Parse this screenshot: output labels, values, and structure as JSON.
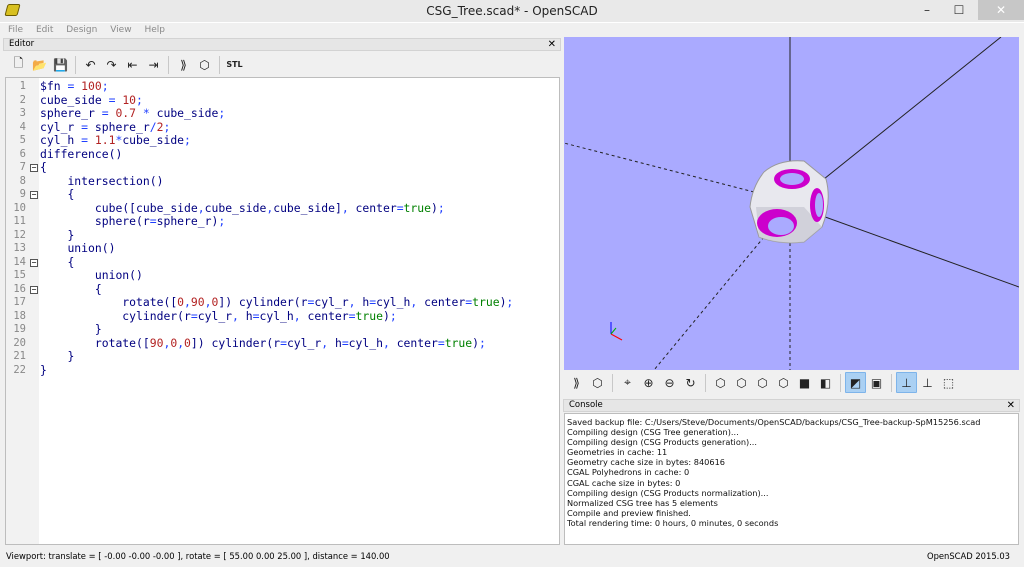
{
  "window": {
    "title": "CSG_Tree.scad* - OpenSCAD",
    "minimize": "–",
    "maximize": "☐",
    "close": "✕"
  },
  "menu": [
    "File",
    "Edit",
    "Design",
    "View",
    "Help"
  ],
  "editor": {
    "title": "Editor",
    "close": "✕",
    "toolbar": [
      {
        "name": "new-icon",
        "glyph": "🗋"
      },
      {
        "name": "open-icon",
        "glyph": "📂"
      },
      {
        "name": "save-icon",
        "glyph": "💾"
      },
      {
        "sep": true
      },
      {
        "name": "undo-icon",
        "glyph": "↶"
      },
      {
        "name": "redo-icon",
        "glyph": "↷"
      },
      {
        "name": "unindent-icon",
        "glyph": "⇤"
      },
      {
        "name": "indent-icon",
        "glyph": "⇥"
      },
      {
        "sep": true
      },
      {
        "name": "preview-icon",
        "glyph": "⟫"
      },
      {
        "name": "render-icon",
        "glyph": "⬡"
      },
      {
        "sep": true
      },
      {
        "name": "export-stl-icon",
        "glyph": "STL"
      }
    ],
    "lines": [
      "$fn = 100;",
      "cube_side = 10;",
      "sphere_r = 0.7 * cube_side;",
      "cyl_r = sphere_r/2;",
      "cyl_h = 1.1*cube_side;",
      "difference()",
      "{",
      "    intersection()",
      "    {",
      "        cube([cube_side,cube_side,cube_side], center=true);",
      "        sphere(r=sphere_r);",
      "    }",
      "    union()",
      "    {",
      "        union()",
      "        {",
      "            rotate([0,90,0]) cylinder(r=cyl_r, h=cyl_h, center=true);",
      "            cylinder(r=cyl_r, h=cyl_h, center=true);",
      "        }",
      "        rotate([90,0,0]) cylinder(r=cyl_r, h=cyl_h, center=true);",
      "    }",
      "}"
    ],
    "fold_lines": [
      7,
      9,
      14,
      16
    ]
  },
  "view_toolbar": [
    {
      "name": "preview-icon",
      "glyph": "⟫"
    },
    {
      "name": "render-icon",
      "glyph": "⬡"
    },
    {
      "sep": true
    },
    {
      "name": "view-all-icon",
      "glyph": "⌖"
    },
    {
      "name": "zoom-in-icon",
      "glyph": "⊕"
    },
    {
      "name": "zoom-out-icon",
      "glyph": "⊖"
    },
    {
      "name": "reset-view-icon",
      "glyph": "↻"
    },
    {
      "sep": true
    },
    {
      "name": "view-right-icon",
      "glyph": "⬡"
    },
    {
      "name": "view-top-icon",
      "glyph": "⬡"
    },
    {
      "name": "view-bottom-icon",
      "glyph": "⬡"
    },
    {
      "name": "view-left-icon",
      "glyph": "⬡"
    },
    {
      "name": "view-front-icon",
      "glyph": "■"
    },
    {
      "name": "view-back-icon",
      "glyph": "◧"
    },
    {
      "sep": true
    },
    {
      "name": "perspective-icon",
      "glyph": "◩",
      "on": true
    },
    {
      "name": "orthogonal-icon",
      "glyph": "▣"
    },
    {
      "sep": true
    },
    {
      "name": "show-axes-icon",
      "glyph": "⊥",
      "on": true
    },
    {
      "name": "show-scale-icon",
      "glyph": "⊥"
    },
    {
      "name": "show-edges-icon",
      "glyph": "⬚"
    }
  ],
  "console": {
    "title": "Console",
    "close": "✕",
    "lines": [
      "Saved backup file: C:/Users/Steve/Documents/OpenSCAD/backups/CSG_Tree-backup-SpM15256.scad",
      "Compiling design (CSG Tree generation)...",
      "Compiling design (CSG Products generation)...",
      "Geometries in cache: 11",
      "Geometry cache size in bytes: 840616",
      "CGAL Polyhedrons in cache: 0",
      "CGAL cache size in bytes: 0",
      "Compiling design (CSG Products normalization)...",
      "Normalized CSG tree has 5 elements",
      "Compile and preview finished.",
      "Total rendering time: 0 hours, 0 minutes, 0 seconds"
    ]
  },
  "status": {
    "viewport": "Viewport: translate = [ -0.00 -0.00 -0.00 ], rotate = [ 55.00 0.00 25.00 ], distance = 140.00",
    "version": "OpenSCAD 2015.03"
  },
  "colors": {
    "viewport_bg": "#aaaaff",
    "object": "#e6e6ea",
    "cutout": "#cc00cc"
  }
}
